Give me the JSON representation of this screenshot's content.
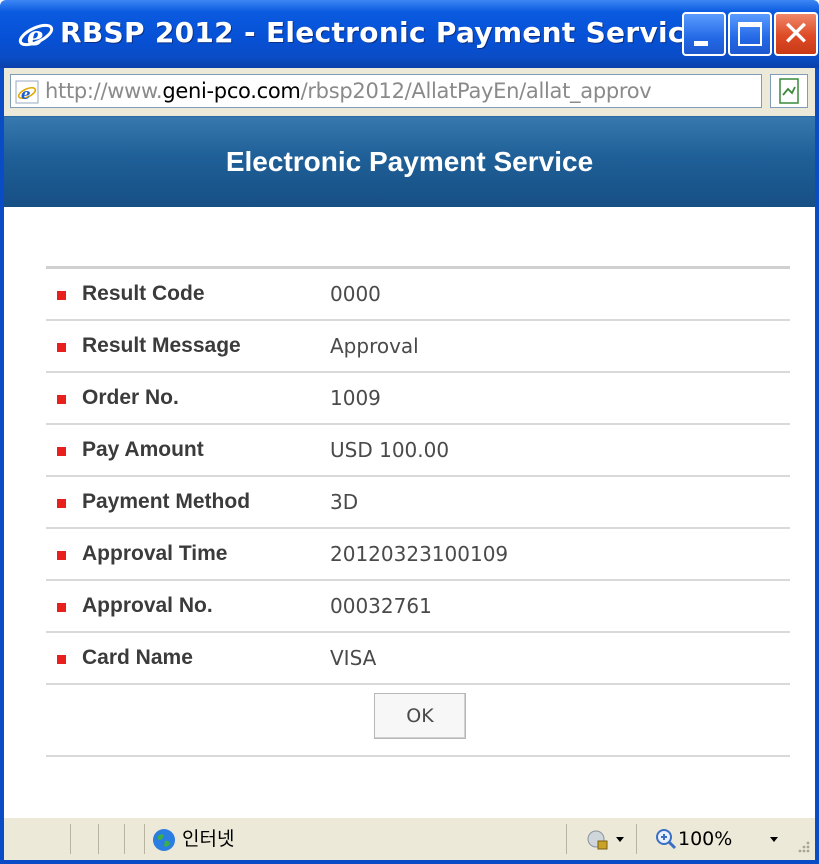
{
  "window": {
    "title": "RBSP 2012 - Electronic Payment Service...",
    "icon": "ie-icon",
    "buttons": [
      "minimize",
      "maximize",
      "close"
    ]
  },
  "address_bar": {
    "url_prefix": "http://www.",
    "url_host": "geni-pco.com",
    "url_path": "/rbsp2012/AllatPayEn/allat_approv"
  },
  "page": {
    "header_title": "Electronic Payment Service",
    "rows": [
      {
        "label": "Result Code",
        "value": "0000"
      },
      {
        "label": "Result Message",
        "value": "Approval"
      },
      {
        "label": "Order No.",
        "value": "1009"
      },
      {
        "label": "Pay Amount",
        "value": "USD 100.00"
      },
      {
        "label": "Payment Method",
        "value": "3D"
      },
      {
        "label": "Approval Time",
        "value": "20120323100109"
      },
      {
        "label": "Approval No.",
        "value": "00032761"
      },
      {
        "label": "Card Name",
        "value": "VISA"
      }
    ],
    "ok_label": "OK"
  },
  "status_bar": {
    "zone": "인터넷",
    "zoom": "100%"
  },
  "colors": {
    "titlebar": "#0651d6",
    "header": "#1f5f97",
    "bullet": "#e8201d",
    "close_button": "#de4a25"
  }
}
